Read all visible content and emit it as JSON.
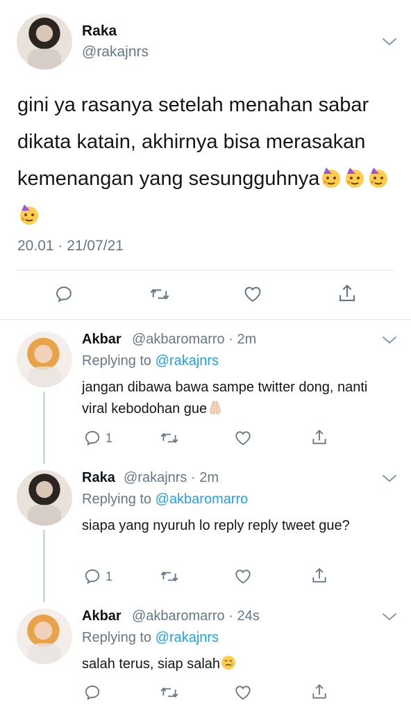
{
  "main": {
    "name": "Raka",
    "handle": "@rakajnrs",
    "text": "gini ya rasanya setelah menahan sabar dikata katain, akhirnya bisa merasakan kemenangan yang sesungguhnya",
    "text_emoji": "partying-face",
    "timestamp": "20.01 · 21/07/21"
  },
  "replies": [
    {
      "name": "Akbar",
      "handle": "@akbaromarro",
      "time": "2m",
      "replying_prefix": "Replying to",
      "replying_to": "@rakajnrs",
      "text": "jangan dibawa bawa sampe twitter dong, nanti viral kebodohan gue",
      "emoji": "folded-hands",
      "reply_count": "1"
    },
    {
      "name": "Raka",
      "handle": "@rakajnrs",
      "time": "2m",
      "replying_prefix": "Replying to",
      "replying_to": "@akbaromarro",
      "text": "siapa yang nyuruh lo reply reply tweet gue?",
      "reply_count": "1"
    },
    {
      "name": "Akbar",
      "handle": "@akbaromarro",
      "time": "24s",
      "replying_prefix": "Replying to",
      "replying_to": "@rakajnrs",
      "text": "salah terus, siap salah",
      "emoji": "crying-smiling-face",
      "reply_count": ""
    }
  ],
  "colors": {
    "text": "#0f1419",
    "secondary": "#657786",
    "link": "#1da1f2",
    "divider": "#e1e8ed"
  },
  "icons": [
    "reply-icon",
    "retweet-icon",
    "like-icon",
    "share-icon",
    "chevron-down-icon"
  ]
}
